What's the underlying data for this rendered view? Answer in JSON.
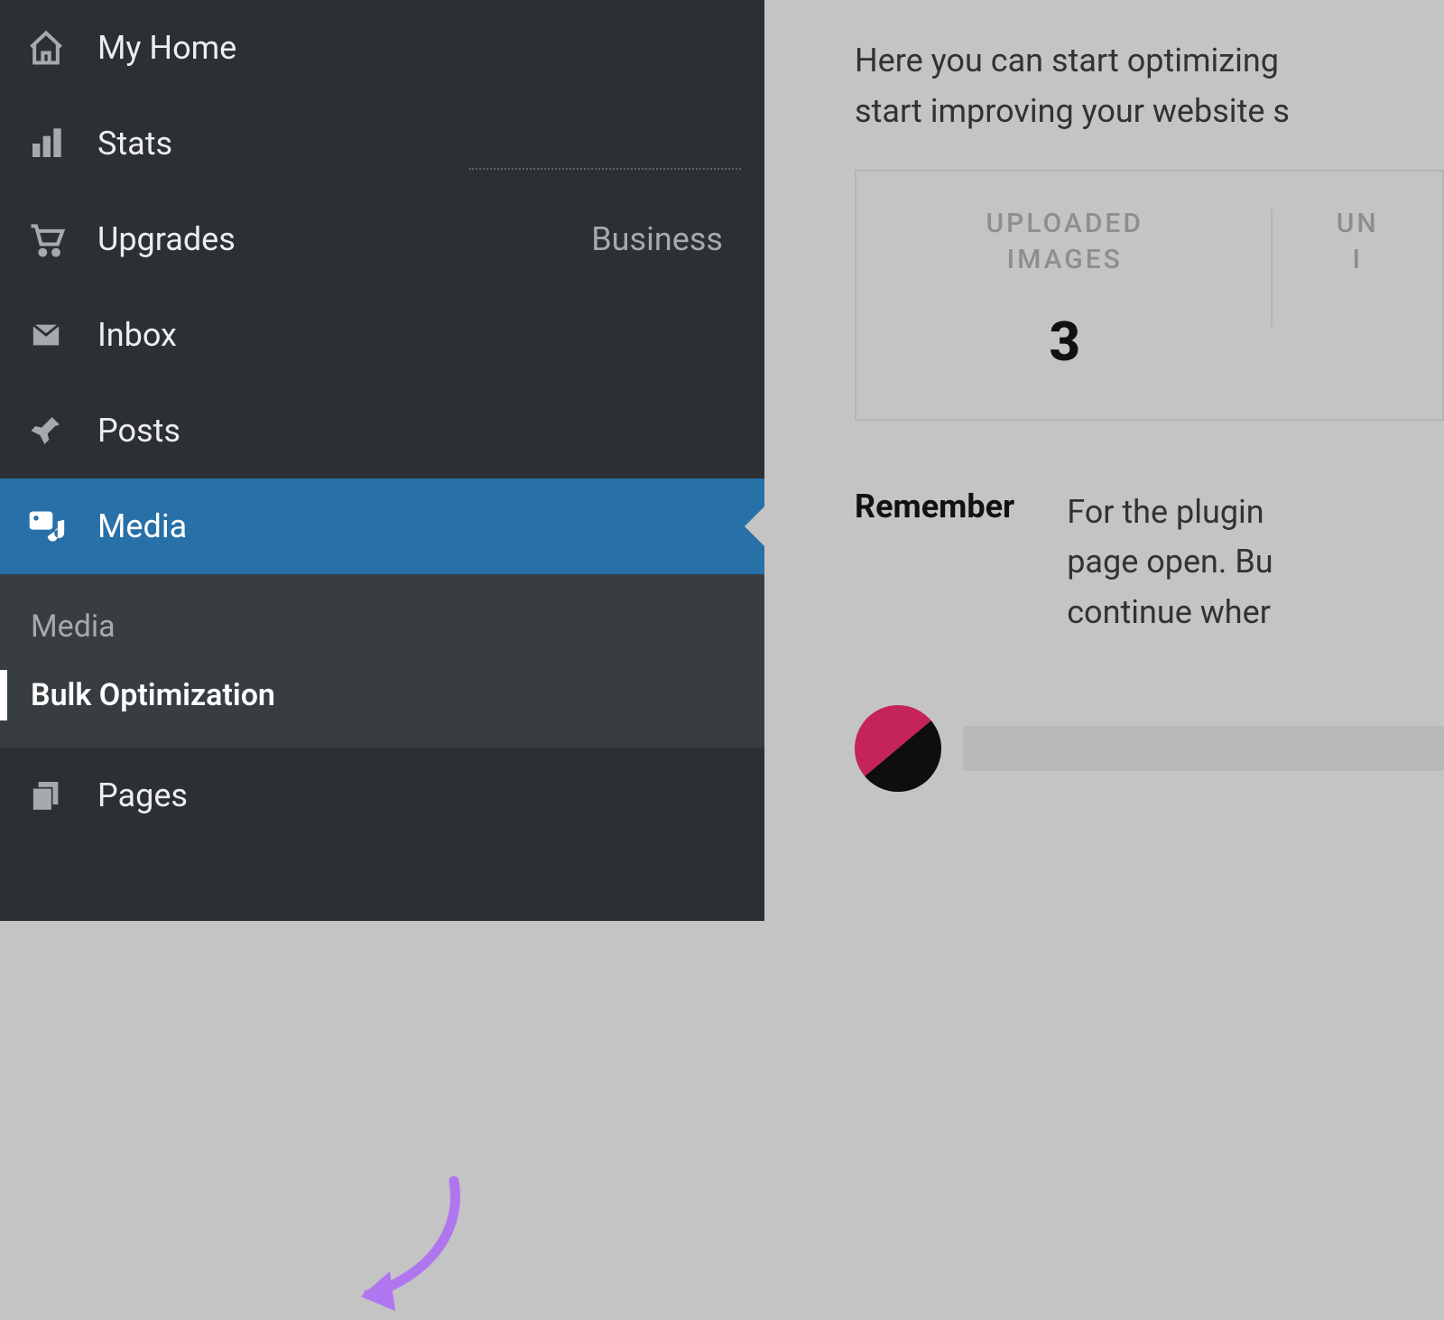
{
  "sidebar": {
    "items": [
      {
        "label": "My Home"
      },
      {
        "label": "Stats"
      },
      {
        "label": "Upgrades",
        "badge": "Business"
      },
      {
        "label": "Inbox"
      },
      {
        "label": "Posts"
      },
      {
        "label": "Media"
      },
      {
        "label": "Pages"
      }
    ],
    "submenu": {
      "header": "Media",
      "items": [
        {
          "label": "Bulk Optimization"
        }
      ]
    }
  },
  "main": {
    "intro_line1": "Here you can start optimizing",
    "intro_line2": "start improving your website s",
    "stats": [
      {
        "label_line1": "UPLOADED",
        "label_line2": "IMAGES",
        "value": "3"
      },
      {
        "label_line1": "UN",
        "label_line2": "I"
      }
    ],
    "remember_label": "Remember",
    "remember_line1": "For the plugin",
    "remember_line2": "page open. Bu",
    "remember_line3": "continue wher"
  }
}
